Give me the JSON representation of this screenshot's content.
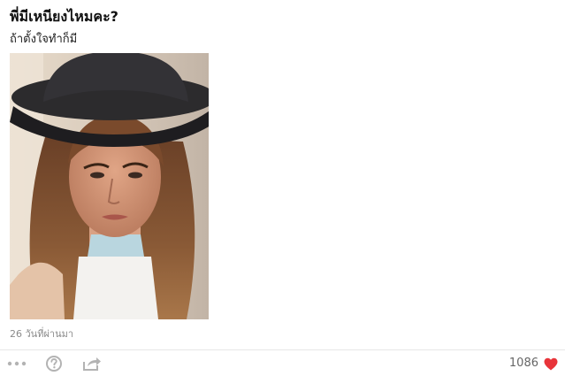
{
  "post": {
    "title": "พี่มีเหนียงไหมคะ?",
    "caption": "ถ้าตั้งใจทำก็มี",
    "timestamp": "26 วันที่ผ่านมา",
    "photo_alt": ""
  },
  "footer": {
    "like_count": "1086",
    "icons": {
      "more": "more-dots-icon",
      "question": "question-icon",
      "share": "share-icon",
      "like": "heart-icon"
    },
    "colors": {
      "icon": "#b3b3b3",
      "heart": "#e8343a",
      "count": "#666666"
    }
  }
}
